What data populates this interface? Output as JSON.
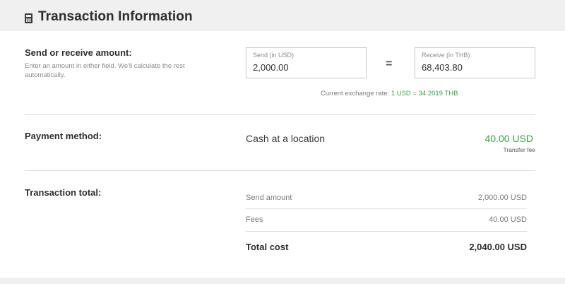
{
  "header": {
    "title": "Transaction Information",
    "icon": "calculator-icon"
  },
  "amount": {
    "label": "Send or receive amount:",
    "help": "Enter an amount in either field. We'll calculate the rest automatically.",
    "send_label": "Send (in USD)",
    "send_value": "2,000.00",
    "equals": "=",
    "receive_label": "Receive (in THB)",
    "receive_value": "68,403.80",
    "rate_prefix": "Current exchange rate: ",
    "rate_value": "1 USD = 34.2019 THB"
  },
  "payment": {
    "label": "Payment method:",
    "method": "Cash at a location",
    "fee": "40.00 USD",
    "fee_caption": "Transfer fee"
  },
  "total": {
    "label": "Transaction total:",
    "rows": [
      {
        "label": "Send amount",
        "value": "2,000.00 USD"
      },
      {
        "label": "Fees",
        "value": "40.00 USD"
      },
      {
        "label": "Total cost",
        "value": "2,040.00 USD"
      }
    ]
  },
  "colors": {
    "accent_green": "#3aa34a",
    "header_bg": "#f0f0f0"
  }
}
